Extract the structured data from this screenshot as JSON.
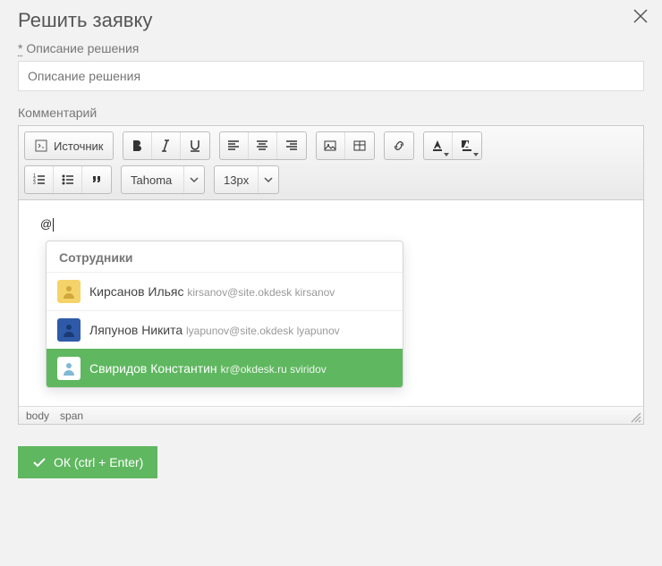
{
  "modal": {
    "title": "Решить заявку",
    "close_label": "Закрыть"
  },
  "fields": {
    "solution": {
      "required_mark": "*",
      "label": "Описание решения",
      "placeholder": "Описание решения"
    },
    "comment": {
      "label": "Комментарий"
    }
  },
  "toolbar": {
    "source_label": "Источник",
    "font_name": "Tahoma",
    "font_size": "13px",
    "icons": {
      "source": "source-icon",
      "bold": "bold-icon",
      "italic": "italic-icon",
      "underline": "underline-icon",
      "align_left": "align-left-icon",
      "align_center": "align-center-icon",
      "align_right": "align-right-icon",
      "image": "image-icon",
      "table": "table-icon",
      "link": "link-icon",
      "text_color": "text-color-icon",
      "bg_color": "bg-color-icon",
      "num_list": "numbered-list-icon",
      "bul_list": "bulleted-list-icon",
      "quote": "quote-icon"
    }
  },
  "editor": {
    "typed": "@",
    "path": [
      "body",
      "span"
    ]
  },
  "mention": {
    "header": "Сотрудники",
    "items": [
      {
        "name": "Кирсанов Ильяс",
        "email": "kirsanov@site.okdesk kirsanov",
        "selected": false,
        "avatar_color": "#f4d36a"
      },
      {
        "name": "Ляпунов Никита",
        "email": "lyapunov@site.okdesk lyapunov",
        "selected": false,
        "avatar_color": "#2e5aa8"
      },
      {
        "name": "Свиридов Константин",
        "email": "kr@okdesk.ru sviridov",
        "selected": true,
        "avatar_color": "#c9e8f5"
      }
    ]
  },
  "footer": {
    "ok_label": "ОК (ctrl + Enter)"
  },
  "colors": {
    "accent": "#5fb760"
  }
}
